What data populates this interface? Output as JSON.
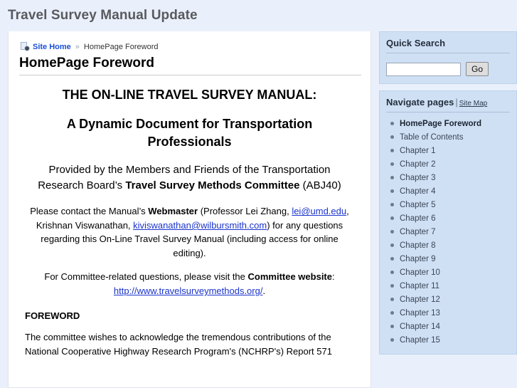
{
  "header": {
    "title": "Travel Survey Manual Update"
  },
  "breadcrumb": {
    "home_label": "Site Home",
    "separator": "»",
    "current": "HomePage Foreword"
  },
  "content": {
    "page_title": "HomePage Foreword",
    "heading_main": "THE ON-LINE TRAVEL SURVEY MANUAL:",
    "heading_sub": "A Dynamic Document for Transportation Professionals",
    "provided_by": {
      "part1": "Provided by the Members and Friends of the Transportation Research Board’s ",
      "bold1": "Travel Survey Methods Committee",
      "part2": " (ABJ40)"
    },
    "contact": {
      "part1": "Please contact the Manual’s ",
      "bold1": "Webmaster",
      "part2": " (Professor Lei Zhang, ",
      "link1": "lei@umd.edu",
      "part3": ", Krishnan Viswanathan, ",
      "link2": "kiviswanathan@wilbursmith.com",
      "part4": ") for any questions regarding this On-Line Travel Survey Manual (including access for online editing)."
    },
    "committee": {
      "part1": "For Committee-related questions, please visit the ",
      "bold1": "Committee website",
      "part2": ": ",
      "link1": "http://www.travelsurveymethods.org/",
      "part3": "."
    },
    "foreword_heading": "FOREWORD",
    "foreword_text": "The committee wishes to acknowledge the tremendous contributions of the National Cooperative Highway Research Program's (NCHRP's) Report 571"
  },
  "sidebar": {
    "search": {
      "title": "Quick Search",
      "value": "",
      "placeholder": "",
      "button_label": "Go"
    },
    "navigate": {
      "title": "Navigate pages",
      "separator": "|",
      "sitemap_label": "Site Map",
      "items": [
        {
          "label": "HomePage Foreword",
          "active": true
        },
        {
          "label": "Table of Contents",
          "active": false
        },
        {
          "label": "Chapter 1",
          "active": false
        },
        {
          "label": "Chapter 2",
          "active": false
        },
        {
          "label": "Chapter 3",
          "active": false
        },
        {
          "label": "Chapter 4",
          "active": false
        },
        {
          "label": "Chapter 5",
          "active": false
        },
        {
          "label": "Chapter 6",
          "active": false
        },
        {
          "label": "Chapter 7",
          "active": false
        },
        {
          "label": "Chapter 8",
          "active": false
        },
        {
          "label": "Chapter 9",
          "active": false
        },
        {
          "label": "Chapter 10",
          "active": false
        },
        {
          "label": "Chapter 11",
          "active": false
        },
        {
          "label": "Chapter 12",
          "active": false
        },
        {
          "label": "Chapter 13",
          "active": false
        },
        {
          "label": "Chapter 14",
          "active": false
        },
        {
          "label": "Chapter 15",
          "active": false
        }
      ]
    }
  },
  "colors": {
    "page_background": "#eaf0fb",
    "panel_background": "#cfe0f5",
    "link": "#1a33cc",
    "header_text": "#585a5e"
  }
}
